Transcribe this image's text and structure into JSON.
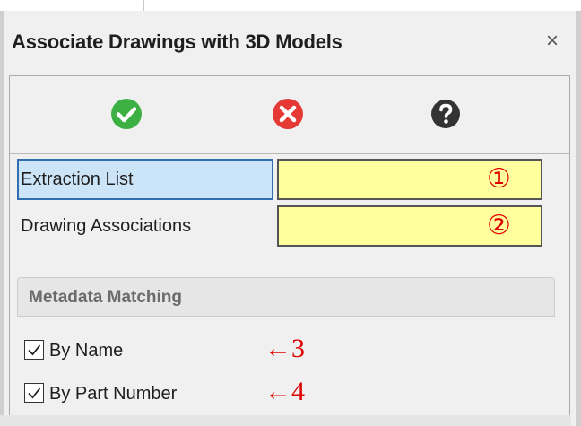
{
  "dialog": {
    "title": "Associate Drawings with 3D Models",
    "close_symbol": "×"
  },
  "toolbar": {
    "ok": {
      "icon": "check-circle-icon",
      "color": "#3cb043"
    },
    "cancel": {
      "icon": "x-circle-icon",
      "color": "#e53935"
    },
    "help": {
      "icon": "question-circle-icon",
      "color": "#333333"
    }
  },
  "selections": [
    {
      "label": "Extraction List",
      "value": "",
      "annotation": "①",
      "selected": true
    },
    {
      "label": "Drawing Associations",
      "value": "",
      "annotation": "②",
      "selected": false
    }
  ],
  "metadata_matching": {
    "header": "Metadata Matching",
    "options": [
      {
        "label": "By Name",
        "checked": true,
        "annotation": "←3"
      },
      {
        "label": "By Part Number",
        "checked": true,
        "annotation": "←4"
      }
    ]
  },
  "colors": {
    "field_bg": "#ffff9e",
    "selected_bg": "#cce4f7",
    "annotation": "#e00000"
  }
}
